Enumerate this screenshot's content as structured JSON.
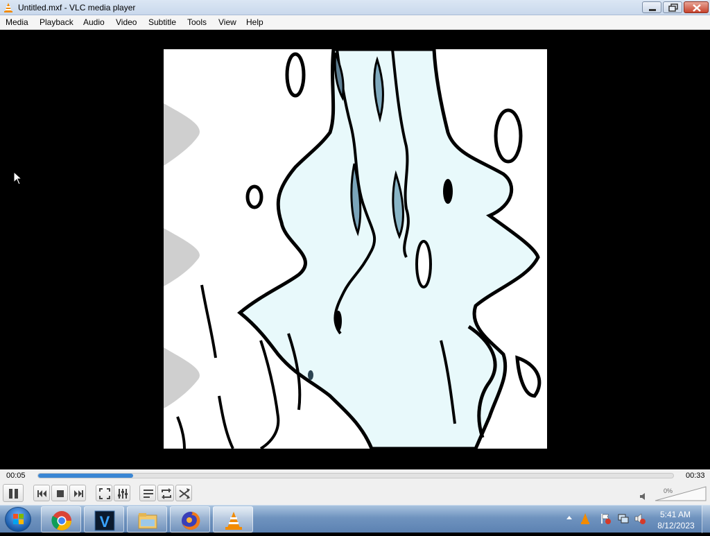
{
  "window": {
    "title": "Untitled.mxf - VLC media player",
    "icon": "vlc-cone-icon"
  },
  "menu": [
    "Media",
    "Playback",
    "Audio",
    "Video",
    "Subtitle",
    "Tools",
    "View",
    "Help"
  ],
  "playback": {
    "elapsed": "00:05",
    "total": "00:33",
    "progress_fraction": 0.15
  },
  "controls": {
    "icons": [
      "pause-icon",
      "previous-icon",
      "stop-icon",
      "next-icon",
      "fullscreen-icon",
      "extended-settings-icon",
      "playlist-icon",
      "loop-icon",
      "shuffle-icon"
    ],
    "volume_label": "0%",
    "volume_fraction": 0.0,
    "muted": true
  },
  "taskbar": {
    "apps": [
      "chrome-icon",
      "vegas-icon",
      "file-explorer-icon",
      "firefox-icon",
      "vlc-icon"
    ],
    "active_app": "vlc-icon",
    "clock_time": "5:41 AM",
    "clock_date": "8/12/2023"
  },
  "colors": {
    "seek_fill": "#3a86d4",
    "video_background": "#000000",
    "taskbar": "#6f93bf"
  }
}
